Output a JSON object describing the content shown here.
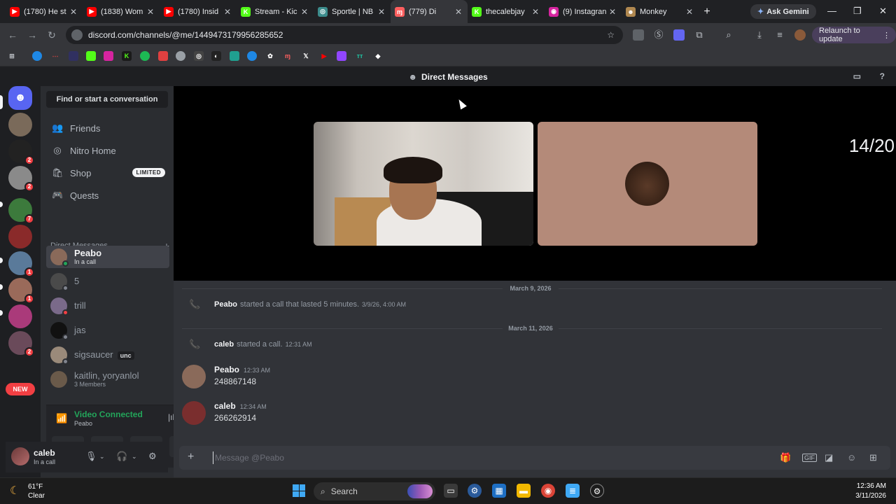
{
  "browser": {
    "tabs": [
      {
        "title": "(1780) He st",
        "color": "#ff0000",
        "glyph": "▶"
      },
      {
        "title": "(1838) Wom",
        "color": "#ff0000",
        "glyph": "▶"
      },
      {
        "title": "(1780) Insid",
        "color": "#ff0000",
        "glyph": "▶"
      },
      {
        "title": "Stream - Kic",
        "color": "#53fc18",
        "glyph": "K"
      },
      {
        "title": "Sportle | NB",
        "color": "#3c8c8c",
        "glyph": "◎"
      },
      {
        "title": "(779) Di",
        "color": "#ff5f5f",
        "glyph": "ɱ"
      },
      {
        "title": "thecalebjay",
        "color": "#53fc18",
        "glyph": "K"
      },
      {
        "title": "(9) Instagran",
        "color": "#d6249f",
        "glyph": "◉"
      },
      {
        "title": "Monkey",
        "color": "#b08850",
        "glyph": "☻"
      }
    ],
    "active_tab_index": 5,
    "ask_gemini": "Ask Gemini",
    "url": "discord.com/channels/@me/1449473179956285652",
    "relaunch": "Relaunch to update"
  },
  "discord": {
    "topbar_title": "Direct Messages",
    "search_placeholder": "Find or start a conversation",
    "nav": [
      {
        "label": "Friends",
        "icon": "friends-icon",
        "glyph": "👥"
      },
      {
        "label": "Nitro Home",
        "icon": "nitro-icon",
        "glyph": "◎"
      },
      {
        "label": "Shop",
        "icon": "shop-icon",
        "glyph": "🛍"
      },
      {
        "label": "Quests",
        "icon": "quests-icon",
        "glyph": "🎮"
      }
    ],
    "shop_badge": "LIMITED",
    "dm_header": "Direct Messages",
    "dms": [
      {
        "name": "Peabo",
        "sub": "In a call",
        "color": "#8a6a5a",
        "status": "#23a55a",
        "active": true
      },
      {
        "name": "5",
        "sub": "",
        "color": "#4a4a4a",
        "status": "#80848e"
      },
      {
        "name": "trill",
        "sub": "",
        "color": "#7a6a8a",
        "status": "#f23f43"
      },
      {
        "name": "jas",
        "sub": "",
        "color": "#111111",
        "status": "#80848e"
      },
      {
        "name": "sigsaucer",
        "sub": "",
        "color": "#9a8a7a",
        "status": "#80848e",
        "tag": "unc"
      },
      {
        "name": "kaitlin, yoryanlol",
        "sub": "3 Members",
        "color": "#6a5a4a",
        "status": ""
      }
    ],
    "voice": {
      "title": "Video Connected",
      "subtitle": "Peabo"
    },
    "user": {
      "name": "caleb",
      "status": "In a call"
    },
    "call_counter": "14/20",
    "dividers": [
      "March 9, 2026",
      "March 11, 2026"
    ],
    "system_messages": [
      {
        "user": "Peabo",
        "text": "started a call that lasted 5 minutes.",
        "time": "3/9/26, 4:00 AM"
      },
      {
        "user": "caleb",
        "text": "started a call.",
        "time": "12:31 AM"
      }
    ],
    "messages": [
      {
        "user": "Peabo",
        "time": "12:33 AM",
        "body": "248867148",
        "color": "#8a6a5a"
      },
      {
        "user": "caleb",
        "time": "12:34 AM",
        "body": "266262914",
        "color": "#8a3a3a"
      }
    ],
    "composer_placeholder": "Message @Peabo"
  },
  "guild_badges": [
    "2",
    "2",
    "7",
    "1",
    "1",
    "2"
  ],
  "new_badge": "NEW",
  "taskbar": {
    "temp": "61°F",
    "condition": "Clear",
    "search": "Search",
    "time": "12:36 AM",
    "date": "3/11/2026"
  }
}
